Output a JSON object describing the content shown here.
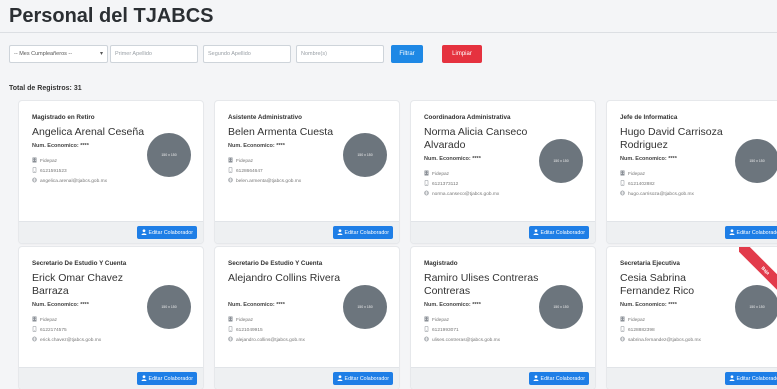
{
  "page": {
    "title": "Personal del TJABCS"
  },
  "filters": {
    "month_select": "-- Mes Cumpleañeros --",
    "first_surname_placeholder": "Primer Apellido",
    "second_surname_placeholder": "Segundo Apellido",
    "name_placeholder": "Nombre(s)",
    "filter_label": "Filtrar",
    "clear_label": "Limpiar"
  },
  "total_label": "Total de Registros: 31",
  "employees": [
    {
      "role": "Magistrado en Retiro",
      "name": "Angelica Arenal Ceseña",
      "num_label": "Num. Economico: ****",
      "dept": "Fidepaz",
      "phone": "6121591523",
      "email": "angelica.arenal@tjabcs.gob.mx",
      "avatar_text": "150 x 150",
      "edit_label": "Editar Colaborador"
    },
    {
      "role": "Asistente Administrativo",
      "name": "Belen Armenta Cuesta",
      "num_label": "Num. Economico: ****",
      "dept": "Fidepaz",
      "phone": "6128664647",
      "email": "belen.armenta@tjabcs.gob.mx",
      "avatar_text": "150 x 150",
      "edit_label": "Editar Colaborador"
    },
    {
      "role": "Coordinadora Administrativa",
      "name": "Norma Alicia Canseco Alvarado",
      "num_label": "Num. Economico: ****",
      "dept": "Fidepaz",
      "phone": "6121373112",
      "email": "norma.canseco@tjabcs.gob.mx",
      "avatar_text": "150 x 150",
      "edit_label": "Editar Colaborador"
    },
    {
      "role": "Jefe de Informatica",
      "name": "Hugo David Carrisoza Rodriguez",
      "num_label": "Num. Economico: ****",
      "dept": "Fidepaz",
      "phone": "6121402882",
      "email": "hugo.carrisoza@tjabcs.gob.mx",
      "avatar_text": "150 x 150",
      "edit_label": "Editar Colaborador"
    },
    {
      "role": "Secretario De Estudio Y Cuenta",
      "name": "Erick Omar Chavez Barraza",
      "num_label": "Num. Economico: ****",
      "dept": "Fidepaz",
      "phone": "6122174575",
      "email": "erick.chavez@tjabcs.gob.mx",
      "avatar_text": "150 x 150",
      "edit_label": "Editar Colaborador"
    },
    {
      "role": "Secretario De Estudio Y Cuenta",
      "name": "Alejandro Collins Rivera",
      "num_label": "Num. Economico: ****",
      "dept": "Fidepaz",
      "phone": "6121049915",
      "email": "alejandro.collins@tjabcs.gob.mx",
      "avatar_text": "150 x 150",
      "edit_label": "Editar Colaborador"
    },
    {
      "role": "Magistrado",
      "name": "Ramiro Ulises Contreras Contreras",
      "num_label": "Num. Economico: ****",
      "dept": "Fidepaz",
      "phone": "6121993071",
      "email": "ulises.contreras@tjabcs.gob.mx",
      "avatar_text": "150 x 150",
      "edit_label": "Editar Colaborador"
    },
    {
      "role": "Secretaria Ejecutiva",
      "name": "Cesia Sabrina Fernandez Rico",
      "num_label": "Num. Economico: ****",
      "dept": "Fidepaz",
      "phone": "6128882398",
      "email": "sabrina.fernandez@tjabcs.gob.mx",
      "avatar_text": "150 x 150",
      "edit_label": "Editar Colaborador",
      "ribbon": "Baja"
    }
  ]
}
